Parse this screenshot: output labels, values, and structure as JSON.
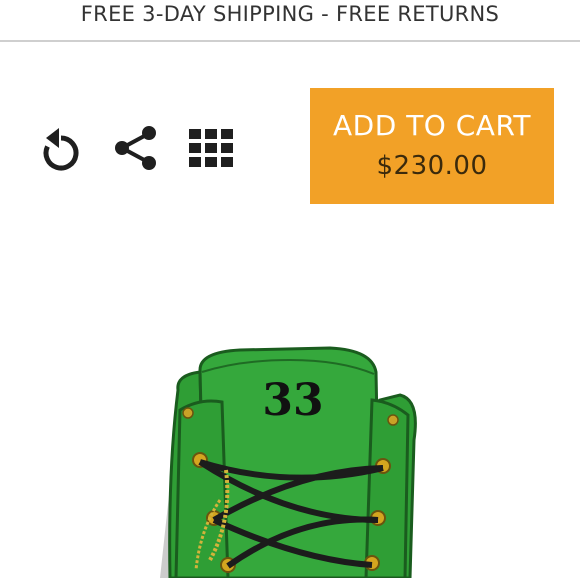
{
  "banner": {
    "text": "FREE 3-DAY SHIPPING - FREE RETURNS"
  },
  "toolbar": {
    "icons": [
      "reset-icon",
      "share-icon",
      "grid-icon"
    ]
  },
  "cart": {
    "label": "ADD TO CART",
    "price": "$230.00",
    "color": "#f2a127"
  },
  "product": {
    "tongue_text": "33",
    "boot_color": "#2f9e35",
    "icon": "boot-image"
  }
}
